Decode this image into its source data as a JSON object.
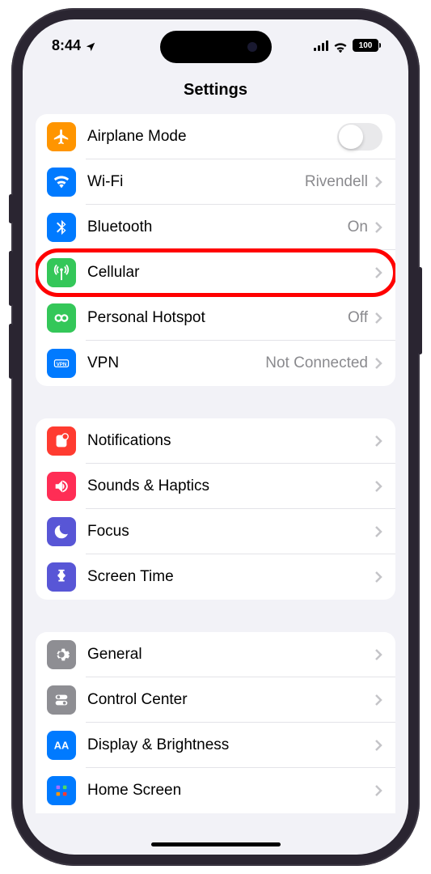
{
  "status": {
    "time": "8:44",
    "battery": "100"
  },
  "header": {
    "title": "Settings"
  },
  "g1": {
    "airplane": {
      "label": "Airplane Mode"
    },
    "wifi": {
      "label": "Wi-Fi",
      "value": "Rivendell"
    },
    "bluetooth": {
      "label": "Bluetooth",
      "value": "On"
    },
    "cellular": {
      "label": "Cellular"
    },
    "hotspot": {
      "label": "Personal Hotspot",
      "value": "Off"
    },
    "vpn": {
      "label": "VPN",
      "value": "Not Connected"
    }
  },
  "g2": {
    "notifications": {
      "label": "Notifications"
    },
    "sounds": {
      "label": "Sounds & Haptics"
    },
    "focus": {
      "label": "Focus"
    },
    "screentime": {
      "label": "Screen Time"
    }
  },
  "g3": {
    "general": {
      "label": "General"
    },
    "controlcenter": {
      "label": "Control Center"
    },
    "display": {
      "label": "Display & Brightness"
    },
    "homescreen": {
      "label": "Home Screen"
    }
  }
}
